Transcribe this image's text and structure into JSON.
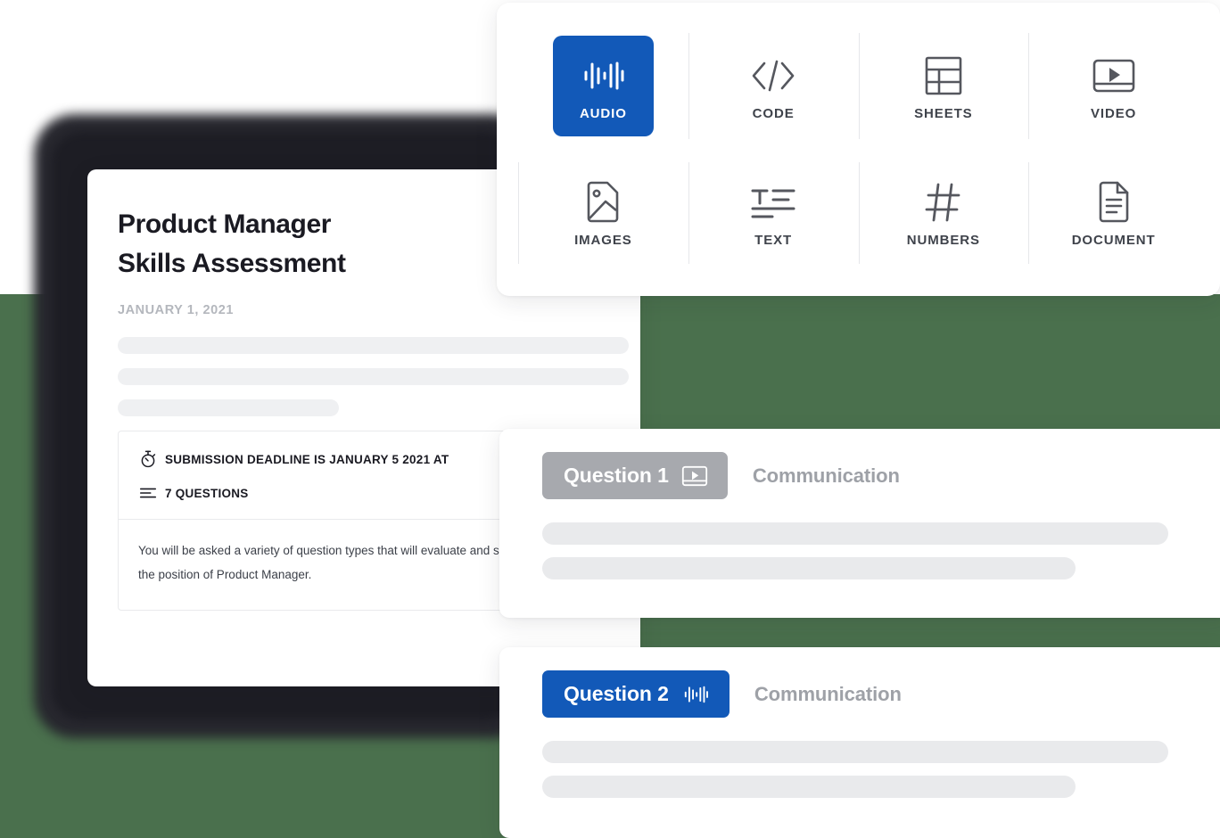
{
  "palette": {
    "background_green": "#4A704D",
    "accent_blue": "#1259B8",
    "badge_gray": "#A7A9AE",
    "skeleton_gray": "#EFF0F2",
    "device_dark": "#27272E",
    "text_dark": "#1A1A22",
    "text_muted": "#B4B7BD"
  },
  "document": {
    "title": "Product Manager\nSkills Assessment",
    "date": "JANUARY 1, 2021",
    "meta": {
      "deadline_icon": "stopwatch-icon",
      "deadline": "SUBMISSION DEADLINE IS JANUARY 5 2021 AT",
      "questions_icon": "list-lines-icon",
      "questions": "7 QUESTIONS"
    },
    "body": "You will be asked a variety of question types that will evaluate and skills related to the position of Product Manager."
  },
  "type_picker": {
    "items": [
      {
        "label": "AUDIO",
        "icon": "audio-waveform-icon",
        "selected": true
      },
      {
        "label": "CODE",
        "icon": "code-brackets-icon",
        "selected": false
      },
      {
        "label": "SHEETS",
        "icon": "table-grid-icon",
        "selected": false
      },
      {
        "label": "VIDEO",
        "icon": "video-play-icon",
        "selected": false
      },
      {
        "label": "IMAGES",
        "icon": "image-picture-icon",
        "selected": false
      },
      {
        "label": "TEXT",
        "icon": "text-lines-icon",
        "selected": false
      },
      {
        "label": "NUMBERS",
        "icon": "hash-number-icon",
        "selected": false
      },
      {
        "label": "DOCUMENT",
        "icon": "document-page-icon",
        "selected": false
      }
    ]
  },
  "questions": [
    {
      "badge_label": "Question 1",
      "badge_icon": "video-play-icon",
      "badge_color": "#A7A9AE",
      "category": "Communication"
    },
    {
      "badge_label": "Question 2",
      "badge_icon": "audio-waveform-icon",
      "badge_color": "#1259B8",
      "category": "Communication"
    }
  ]
}
